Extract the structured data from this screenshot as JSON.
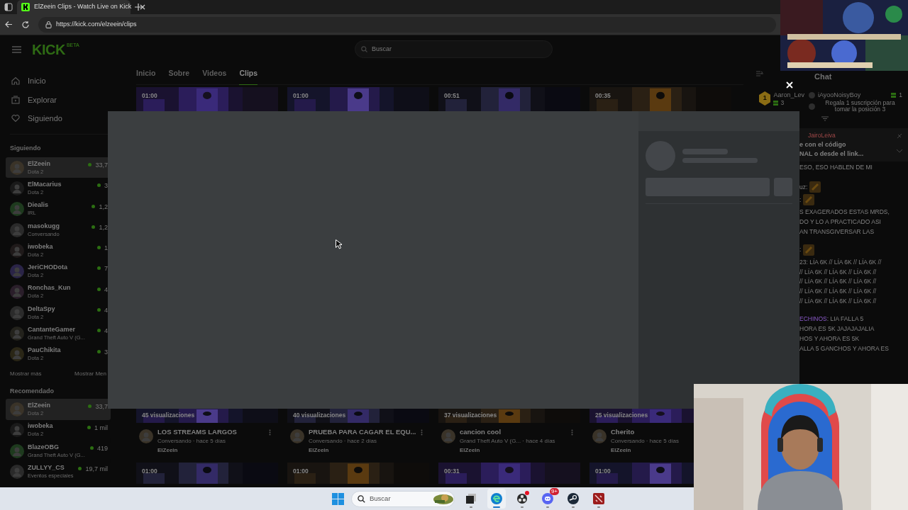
{
  "browser": {
    "tab_title": "ElZeein Clips - Watch Live on Kick",
    "url": "https://kick.com/elzeein/clips"
  },
  "header": {
    "logo": "KICK",
    "logo_tag": "BETA",
    "search_placeholder": "Buscar"
  },
  "nav": [
    {
      "kind": "home",
      "label": "Inicio"
    },
    {
      "kind": "explore",
      "label": "Explorar"
    },
    {
      "kind": "heart",
      "label": "Siguiendo"
    }
  ],
  "following": {
    "title": "Siguiendo",
    "channels": [
      {
        "name": "ElZeein",
        "game": "Dota 2",
        "viewers": "33,7",
        "selected": true
      },
      {
        "name": "ElMacarius",
        "game": "Dota 2",
        "viewers": "3",
        "selected": false
      },
      {
        "name": "Diealis",
        "game": "IRL",
        "viewers": "1,2",
        "selected": false
      },
      {
        "name": "masokugg",
        "game": "Conversando",
        "viewers": "1,2",
        "selected": false
      },
      {
        "name": "iwobeka",
        "game": "Dota 2",
        "viewers": "1",
        "selected": false
      },
      {
        "name": "JeriCHODota",
        "game": "Dota 2",
        "viewers": "7",
        "selected": false
      },
      {
        "name": "Ronchas_Kun",
        "game": "Dota 2",
        "viewers": "4",
        "selected": false
      },
      {
        "name": "DeltaSpy",
        "game": "Dota 2",
        "viewers": "4",
        "selected": false
      },
      {
        "name": "CantanteGamer",
        "game": "Grand Theft Auto V (G...",
        "viewers": "4",
        "selected": false
      },
      {
        "name": "PauChikita",
        "game": "Dota 2",
        "viewers": "3",
        "selected": false
      }
    ],
    "show_more": "Mostrar más",
    "show_less": "Mostrar Men"
  },
  "recommended": {
    "title": "Recomendado",
    "channels": [
      {
        "name": "ElZeein",
        "game": "Dota 2",
        "viewers": "33,7",
        "selected": true
      },
      {
        "name": "iwobeka",
        "game": "Dota 2",
        "viewers": "1 mil",
        "selected": false
      },
      {
        "name": "BlazeOBG",
        "game": "Grand Theft Auto V (G...",
        "viewers": "419",
        "selected": false
      },
      {
        "name": "ZULLYY_CS",
        "game": "Eventos especiales",
        "viewers": "19,7 mil",
        "selected": false
      }
    ]
  },
  "tabs": [
    {
      "label": "Inicio",
      "selected": false
    },
    {
      "label": "Sobre",
      "selected": false
    },
    {
      "label": "Videos",
      "selected": false
    },
    {
      "label": "Clips",
      "selected": true
    }
  ],
  "clips": {
    "top_row": [
      {
        "duration": "01:00"
      },
      {
        "duration": "01:00"
      },
      {
        "duration": "00:51"
      },
      {
        "duration": "00:35"
      }
    ],
    "cards": [
      {
        "views": "45 visualizaciones",
        "title": "LOS STREAMS LARGOS",
        "meta": "Conversando · hace 5 días",
        "author": "ElZeein"
      },
      {
        "views": "40 visualizaciones",
        "title": "PRUEBA PARA CAGAR EL EQU...",
        "meta": "Conversando · hace 2 días",
        "author": "ElZeein"
      },
      {
        "views": "37 visualizaciones",
        "title": "cancion cool",
        "meta": "Grand Theft Auto V (G... · hace 4 días",
        "author": "ElZeein"
      },
      {
        "views": "25 visualizaciones",
        "title": "Cherito",
        "meta": "Conversando · hace 5 días",
        "author": "ElZeein"
      }
    ],
    "bottom_row": [
      {
        "duration": "01:00"
      },
      {
        "duration": "01:00"
      },
      {
        "duration": "00:31"
      },
      {
        "duration": "01:00"
      }
    ]
  },
  "chat": {
    "title": "Chat",
    "leaderboard": [
      {
        "rank": "1",
        "name": "Aaron_Lev",
        "count": "3"
      },
      {
        "name": "iAyooNoisyBoy",
        "count": "1"
      }
    ],
    "cta": "Regala 1 suscripción para tomar la posición 3",
    "pinned": {
      "author": "JairoLeiva",
      "lines": [
        "e con el código",
        "NAL o desde el link..."
      ]
    },
    "messages": [
      {
        "lines": [
          "ESO, ESO HABLEN DE MI"
        ],
        "emote": false
      },
      {
        "lines": [
          "uz:"
        ],
        "emote": true
      },
      {
        "lines": [
          ":"
        ],
        "emote": true
      },
      {
        "lines": [
          "S EXAGERADOS ESTAS MRDS,",
          "DO Y LO A PRACTICADO ASI",
          "AN TRANSGIVERSAR LAS"
        ],
        "emote": false
      },
      {
        "lines": [
          ":"
        ],
        "emote": true
      },
      {
        "lines": [
          "23: LÍA 6K // LÍA 6K // LÍA 6K //",
          "// LÍA 6K // LÍA 6K // LÍA 6K //",
          "// LÍA 6K // LÍA 6K // LÍA 6K //",
          "// LÍA 6K // LÍA 6K // LÍA 6K //",
          "// LÍA 6K // LÍA 6K // LÍA 6K //"
        ],
        "emote": false
      },
      {
        "author": "ECHINOS",
        "lines": [
          ": LIA FALLA 5",
          "HORA ES 5K JAJAJAJALIA",
          "HOS Y AHORA ES 5K",
          "ALLA 5 GANCHOS Y AHORA ES"
        ],
        "emote": false
      }
    ]
  },
  "taskbar": {
    "search_placeholder": "Buscar",
    "apps": [
      {
        "kind": "files",
        "selected": false,
        "dot": false
      },
      {
        "kind": "edge",
        "selected": true,
        "dot": false
      },
      {
        "kind": "obs",
        "selected": false,
        "dot": true
      },
      {
        "kind": "discord",
        "selected": false,
        "dot": false,
        "badge": "9+"
      },
      {
        "kind": "steam",
        "selected": false,
        "dot": false
      },
      {
        "kind": "dota",
        "selected": false,
        "dot": false
      }
    ]
  }
}
